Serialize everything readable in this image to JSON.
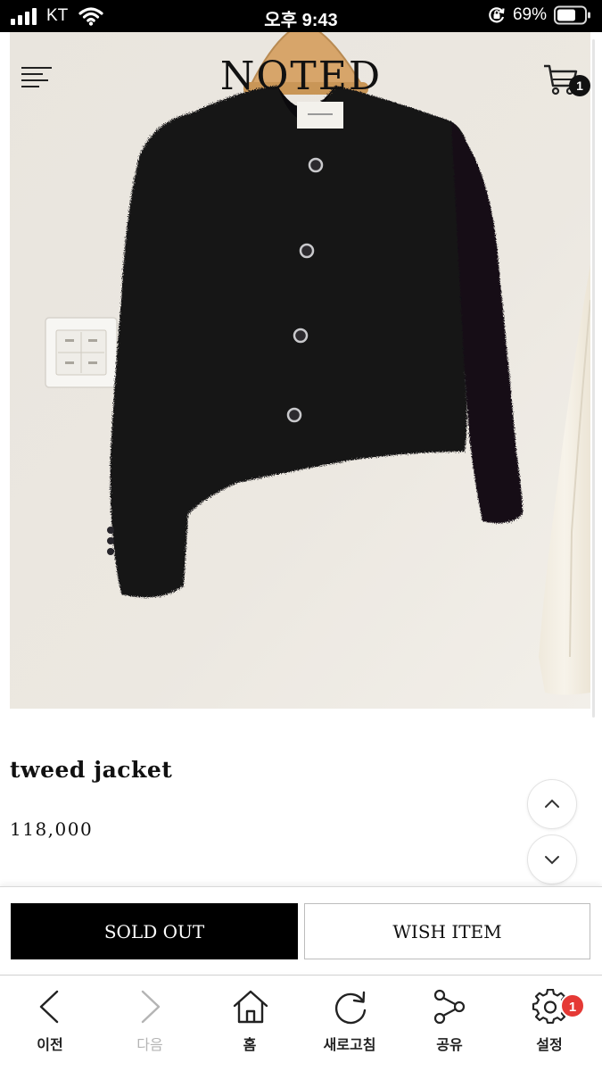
{
  "status_bar": {
    "carrier": "KT",
    "time": "오후 9:43",
    "battery_percent": "69%",
    "battery_level": 0.69
  },
  "header": {
    "brand": "NOTED",
    "cart_count": "1"
  },
  "product": {
    "title": "tweed jacket",
    "price": "118,000",
    "image_icon": "product-photo"
  },
  "actions": {
    "sold_out_label": "SOLD OUT",
    "wish_label": "WISH ITEM"
  },
  "bottom_nav": {
    "items": [
      {
        "label": "이전",
        "icon": "chevron-left-icon"
      },
      {
        "label": "다음",
        "icon": "chevron-right-icon",
        "disabled": true
      },
      {
        "label": "홈",
        "icon": "home-icon"
      },
      {
        "label": "새로고침",
        "icon": "refresh-icon"
      },
      {
        "label": "공유",
        "icon": "share-icon"
      },
      {
        "label": "설정",
        "icon": "gear-icon",
        "badge": "1"
      }
    ]
  },
  "colors": {
    "primary_button": "#000000",
    "badge_red": "#e53935",
    "disabled_text": "#b4b4b4"
  }
}
